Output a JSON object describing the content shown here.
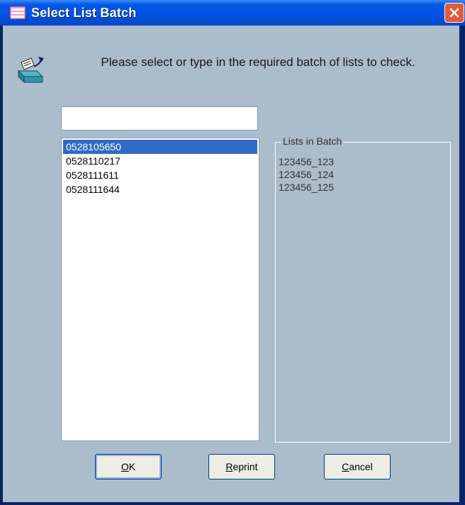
{
  "window": {
    "title": "Select List Batch",
    "close_label": "×"
  },
  "instructions": {
    "text": "Please select or type in the required batch of lists to check."
  },
  "batch_input": {
    "value": "",
    "placeholder": ""
  },
  "batch_list": {
    "items": [
      "0528105650",
      "0528110217",
      "0528111611",
      "0528111644"
    ],
    "selected_index": 0
  },
  "lists_in_batch": {
    "label": "Lists in Batch",
    "items": [
      "123456_123",
      "123456_124",
      "123456_125"
    ]
  },
  "buttons": {
    "ok": {
      "mnemonic": "O",
      "rest": "K"
    },
    "reprint": {
      "mnemonic": "R",
      "rest": "eprint"
    },
    "cancel": {
      "mnemonic": "C",
      "rest": "ancel"
    }
  },
  "colors": {
    "titlebar": "#0054E3",
    "client_bg": "#ABBCCB",
    "selection": "#316AC5",
    "close": "#E35B3A"
  }
}
